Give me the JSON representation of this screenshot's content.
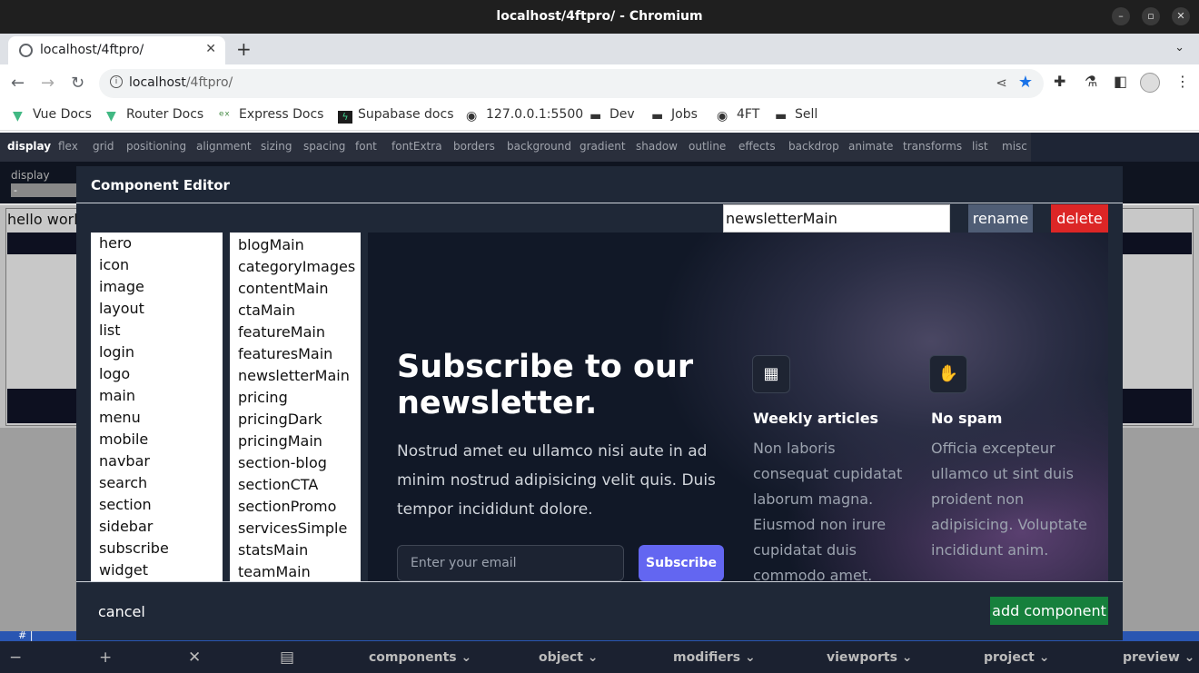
{
  "window": {
    "title": "localhost/4ftpro/ - Chromium"
  },
  "tab": {
    "title": "localhost/4ftpro/"
  },
  "address": {
    "host": "localhost",
    "path": "/4ftpro/"
  },
  "bookmarks": [
    {
      "label": "Vue Docs",
      "icon": "vue-logo"
    },
    {
      "label": "Router Docs",
      "icon": "vue-logo"
    },
    {
      "label": "Express Docs",
      "icon": "express-logo"
    },
    {
      "label": "Supabase docs",
      "icon": "supabase-logo"
    },
    {
      "label": "127.0.0.1:5500",
      "icon": "globe-icon"
    },
    {
      "label": "Dev",
      "icon": "folder-icon"
    },
    {
      "label": "Jobs",
      "icon": "folder-icon"
    },
    {
      "label": "4FT",
      "icon": "globe-icon"
    },
    {
      "label": "Sell",
      "icon": "folder-icon"
    }
  ],
  "app_tabs": [
    "display",
    "flex",
    "grid",
    "positioning",
    "alignment",
    "sizing",
    "spacing",
    "font",
    "fontExtra",
    "borders",
    "background",
    "gradient",
    "shadow",
    "outline",
    "effects",
    "backdrop",
    "animate",
    "transforms",
    "list",
    "misc"
  ],
  "display_panel": {
    "label": "display",
    "value": "-"
  },
  "preview_text": "hello world",
  "status_strip": "# |",
  "modal": {
    "title": "Component Editor",
    "name_value": "newsletterMain",
    "rename_label": "rename",
    "delete_label": "delete",
    "categories": [
      "hero",
      "icon",
      "image",
      "layout",
      "list",
      "login",
      "logo",
      "main",
      "menu",
      "mobile",
      "navbar",
      "search",
      "section",
      "sidebar",
      "subscribe",
      "widget"
    ],
    "components": [
      "blogMain",
      "categoryImages",
      "contentMain",
      "ctaMain",
      "featureMain",
      "featuresMain",
      "newsletterMain",
      "pricing",
      "pricingDark",
      "pricingMain",
      "section-blog",
      "sectionCTA",
      "sectionPromo",
      "servicesSimple",
      "statsMain",
      "teamMain"
    ],
    "cancel_label": "cancel",
    "add_label": "add component"
  },
  "newsletter": {
    "heading": "Subscribe to our newsletter.",
    "body": "Nostrud amet eu ullamco nisi aute in ad minim nostrud adipisicing velit quis. Duis tempor incididunt dolore.",
    "email_placeholder": "Enter your email",
    "subscribe_label": "Subscribe",
    "features": [
      {
        "title": "Weekly articles",
        "desc": "Non laboris consequat cupidatat laborum magna. Eiusmod non irure cupidatat duis commodo amet.",
        "icon": "calendar-icon"
      },
      {
        "title": "No spam",
        "desc": "Officia excepteur ullamco ut sint duis proident non adipisicing. Voluptate incididunt anim.",
        "icon": "hand-icon"
      }
    ]
  },
  "bottom_bar": {
    "menus": [
      "components",
      "object",
      "modifiers",
      "viewports",
      "project",
      "preview"
    ]
  },
  "colors": {
    "accent": "#6366f1",
    "delete": "#dc2626",
    "add": "#16803c",
    "rename": "#4f5d75"
  }
}
